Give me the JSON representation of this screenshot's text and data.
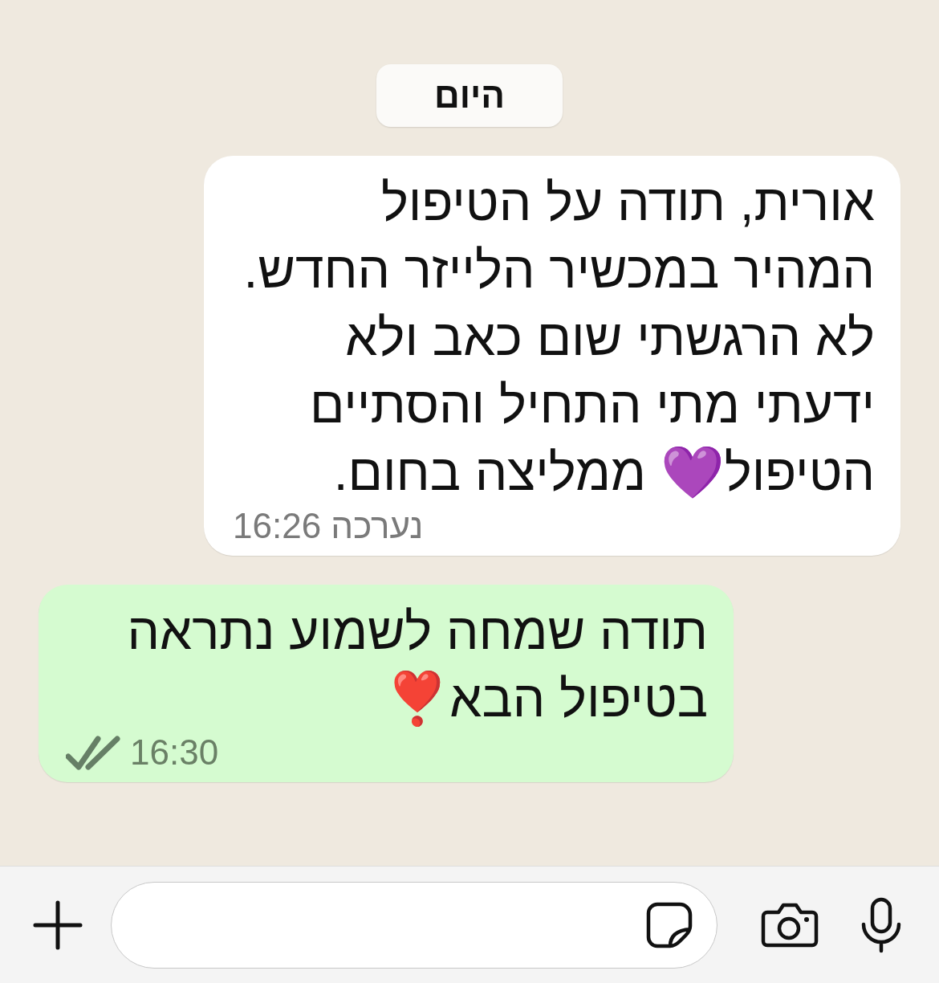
{
  "date_chip": "היום",
  "messages": [
    {
      "kind": "incoming",
      "text": "אורית, תודה על הטיפול המהיר במכשיר הלייזר החדש. לא הרגשתי שום כאב ולא ידעתי מתי התחיל והסתיים הטיפול💜 ממליצה בחום.",
      "edited_label": "נערכה",
      "time": "16:26"
    },
    {
      "kind": "outgoing",
      "text": "תודה שמחה לשמוע נתראה בטיפול הבא❣️",
      "time": "16:30",
      "delivered": true
    }
  ]
}
